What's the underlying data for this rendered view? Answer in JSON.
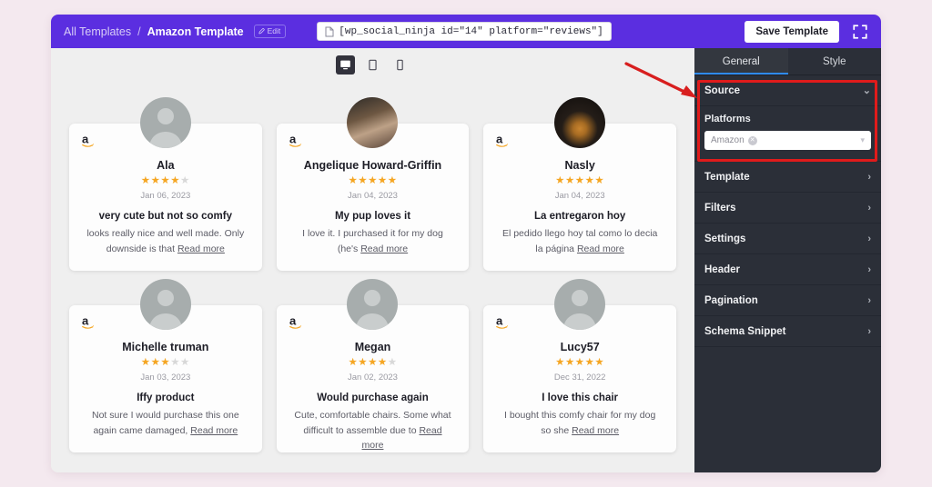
{
  "topbar": {
    "breadcrumb_root": "All Templates",
    "breadcrumb_sep": "/",
    "breadcrumb_current": "Amazon Template",
    "edit_label": "Edit",
    "shortcode": "[wp_social_ninja id=\"14\" platform=\"reviews\"]",
    "save_label": "Save Template",
    "fullscreen_icon": "expand-icon",
    "bar_color": "#5b2ee0"
  },
  "devices": [
    {
      "name": "desktop",
      "icon": "desktop-icon",
      "active": true
    },
    {
      "name": "tablet",
      "icon": "tablet-icon",
      "active": false
    },
    {
      "name": "mobile",
      "icon": "mobile-icon",
      "active": false
    }
  ],
  "sidebar": {
    "tabs": [
      {
        "label": "General",
        "active": true
      },
      {
        "label": "Style",
        "active": false
      }
    ],
    "source": {
      "title": "Source",
      "expanded": true,
      "chevron": "chevron-down-icon",
      "platforms_label": "Platforms",
      "platform_value": "Amazon",
      "remove_icon": "remove-chip-icon",
      "dropdown_icon": "chevron-down-icon"
    },
    "sections": [
      {
        "label": "Template",
        "chevron": "chevron-right-icon"
      },
      {
        "label": "Filters",
        "chevron": "chevron-right-icon"
      },
      {
        "label": "Settings",
        "chevron": "chevron-right-icon"
      },
      {
        "label": "Header",
        "chevron": "chevron-right-icon"
      },
      {
        "label": "Pagination",
        "chevron": "chevron-right-icon"
      },
      {
        "label": "Schema Snippet",
        "chevron": "chevron-right-icon"
      }
    ],
    "bg_color": "#2b2f38",
    "active_tab_underline": "#2f8bf5"
  },
  "annotation": {
    "highlight_color": "#e01b1b",
    "arrow": "red-arrow-pointing-to-source"
  },
  "reviews": [
    {
      "platform_icon": "amazon-logo",
      "avatar_type": "placeholder",
      "name": "Ala",
      "rating": 4,
      "date": "Jan 06, 2023",
      "title": "very cute but not so comfy",
      "body": "looks really nice and well made. Only downside is that ",
      "read_more": "Read more"
    },
    {
      "platform_icon": "amazon-logo",
      "avatar_type": "photo-a",
      "name": "Angelique Howard-Griffin",
      "rating": 5,
      "date": "Jan 04, 2023",
      "title": "My pup loves it",
      "body": "I love it. I purchased it for my dog (he's ",
      "read_more": "Read more"
    },
    {
      "platform_icon": "amazon-logo",
      "avatar_type": "photo-b",
      "name": "Nasly",
      "rating": 5,
      "date": "Jan 04, 2023",
      "title": "La entregaron hoy",
      "body": "El pedido llego hoy tal como lo decia la página ",
      "read_more": "Read more"
    },
    {
      "platform_icon": "amazon-logo",
      "avatar_type": "placeholder",
      "name": "Michelle truman",
      "rating": 3,
      "date": "Jan 03, 2023",
      "title": "Iffy product",
      "body": "Not sure I would purchase this one again came damaged, ",
      "read_more": "Read more"
    },
    {
      "platform_icon": "amazon-logo",
      "avatar_type": "placeholder",
      "name": "Megan",
      "rating": 4,
      "date": "Jan 02, 2023",
      "title": "Would purchase again",
      "body": "Cute, comfortable chairs. Some what difficult to assemble due to ",
      "read_more": "Read more"
    },
    {
      "platform_icon": "amazon-logo",
      "avatar_type": "placeholder",
      "name": "Lucy57",
      "rating": 5,
      "date": "Dec 31, 2022",
      "title": "I love this chair",
      "body": "I bought this comfy chair for my dog so she ",
      "read_more": "Read more"
    }
  ]
}
